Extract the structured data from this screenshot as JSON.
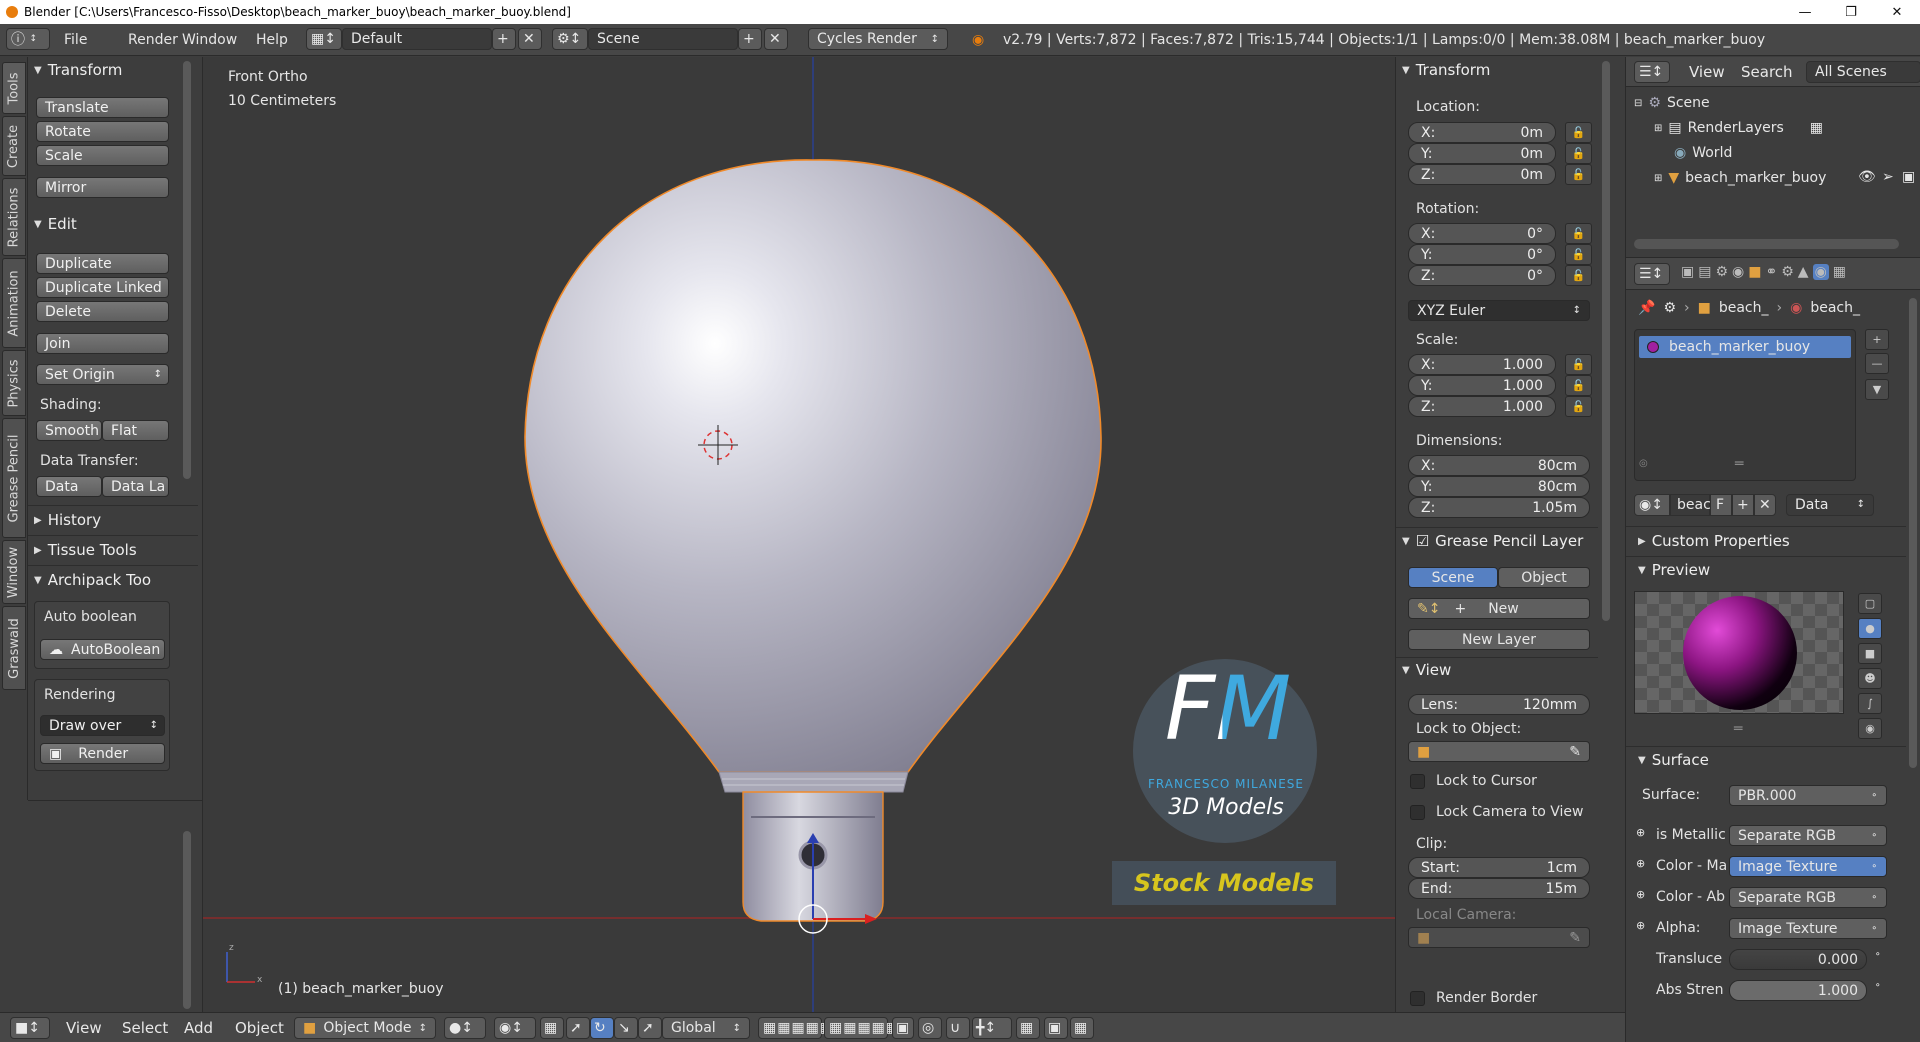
{
  "title_bar": {
    "text": "Blender [C:\\Users\\Francesco-Fisso\\Desktop\\beach_marker_buoy\\beach_marker_buoy.blend]"
  },
  "info_header": {
    "menus": [
      "File",
      "Render",
      "Window",
      "Help"
    ],
    "screen_layout": "Default",
    "scene": "Scene",
    "engine": "Cycles Render",
    "stats": "v2.79 | Verts:7,872 | Faces:7,872 | Tris:15,744 | Objects:1/1 | Lamps:0/0 | Mem:38.08M | beach_marker_buoy"
  },
  "tool_tabs": [
    "Tools",
    "Create",
    "Relations",
    "Animation",
    "Physics",
    "Grease Pencil",
    "Window",
    "Graswald"
  ],
  "tool_shelf": {
    "transform_header": "Transform",
    "translate": "Translate",
    "rotate": "Rotate",
    "scale": "Scale",
    "mirror": "Mirror",
    "edit_header": "Edit",
    "duplicate": "Duplicate",
    "duplicate_linked": "Duplicate Linked",
    "delete": "Delete",
    "join": "Join",
    "set_origin": "Set Origin",
    "shading_label": "Shading:",
    "smooth": "Smooth",
    "flat": "Flat",
    "data_transfer_label": "Data Transfer:",
    "data": "Data",
    "data_la": "Data La",
    "history_header": "History",
    "tissue_header": "Tissue Tools",
    "archipack_header": "Archipack Too",
    "auto_boolean_label": "Auto boolean",
    "autoboolean_btn": "AutoBoolean",
    "rendering_label": "Rendering",
    "draw_over": "Draw over",
    "render_btn": "Render"
  },
  "viewport": {
    "view_name": "Front Ortho",
    "scale": "10 Centimeters",
    "object_label": "(1) beach_marker_buoy",
    "logo_letters": "FM",
    "logo_name": "FRANCESCO MILANESE",
    "logo_sub": "3D Models",
    "logo_badge": "Stock Models"
  },
  "n_panel": {
    "transform_header": "Transform",
    "location_label": "Location:",
    "location": [
      {
        "k": "X:",
        "v": "0m"
      },
      {
        "k": "Y:",
        "v": "0m"
      },
      {
        "k": "Z:",
        "v": "0m"
      }
    ],
    "rotation_label": "Rotation:",
    "rotation": [
      {
        "k": "X:",
        "v": "0°"
      },
      {
        "k": "Y:",
        "v": "0°"
      },
      {
        "k": "Z:",
        "v": "0°"
      }
    ],
    "rotation_mode": "XYZ Euler",
    "scale_label": "Scale:",
    "scale": [
      {
        "k": "X:",
        "v": "1.000"
      },
      {
        "k": "Y:",
        "v": "1.000"
      },
      {
        "k": "Z:",
        "v": "1.000"
      }
    ],
    "dimensions_label": "Dimensions:",
    "dimensions": [
      {
        "k": "X:",
        "v": "80cm"
      },
      {
        "k": "Y:",
        "v": "80cm"
      },
      {
        "k": "Z:",
        "v": "1.05m"
      }
    ],
    "gp_header": "Grease Pencil Layer",
    "gp_scene": "Scene",
    "gp_object": "Object",
    "gp_new": "New",
    "gp_new_layer": "New Layer",
    "view_header": "View",
    "lens": {
      "k": "Lens:",
      "v": "120mm"
    },
    "lock_to_object": "Lock to Object:",
    "lock_to_cursor": "Lock to Cursor",
    "lock_camera": "Lock Camera to View",
    "clip_label": "Clip:",
    "clip_start": {
      "k": "Start:",
      "v": "1cm"
    },
    "clip_end": {
      "k": "End:",
      "v": "15m"
    },
    "local_camera": "Local Camera:",
    "render_border": "Render Border"
  },
  "outliner": {
    "menus": [
      "View",
      "Search"
    ],
    "display_mode": "All Scenes",
    "items": [
      "Scene",
      "RenderLayers",
      "World",
      "beach_marker_buoy"
    ]
  },
  "properties": {
    "breadcrumb": [
      "beach_",
      "beach_"
    ],
    "material_slot": "beach_marker_buoy",
    "mat_name": "beac",
    "mat_f": "F",
    "mat_link": "Data",
    "custom_props": "Custom Properties",
    "preview_header": "Preview",
    "surface_header": "Surface",
    "surface_label": "Surface:",
    "surface_value": "PBR.000",
    "inputs": [
      {
        "k": "is Metallic",
        "v": "Separate RGB"
      },
      {
        "k": "Color - Ma",
        "v": "Image Texture"
      },
      {
        "k": "Color - Ab",
        "v": "Separate RGB"
      },
      {
        "k": "Alpha:",
        "v": "Image Texture"
      }
    ],
    "translucency": {
      "k": "Transluce",
      "v": "0.000"
    },
    "abs_strength": {
      "k": "Abs Stren",
      "v": "1.000"
    }
  },
  "bottom_bar": {
    "menus": [
      "View",
      "Select",
      "Add",
      "Object"
    ],
    "mode": "Object Mode",
    "orientation": "Global"
  },
  "colors": {
    "accent": "#5680c2",
    "selection_outline": "#f08a2a",
    "logo_blue": "#3fa9df",
    "logo_yellow": "#d7c51e"
  }
}
